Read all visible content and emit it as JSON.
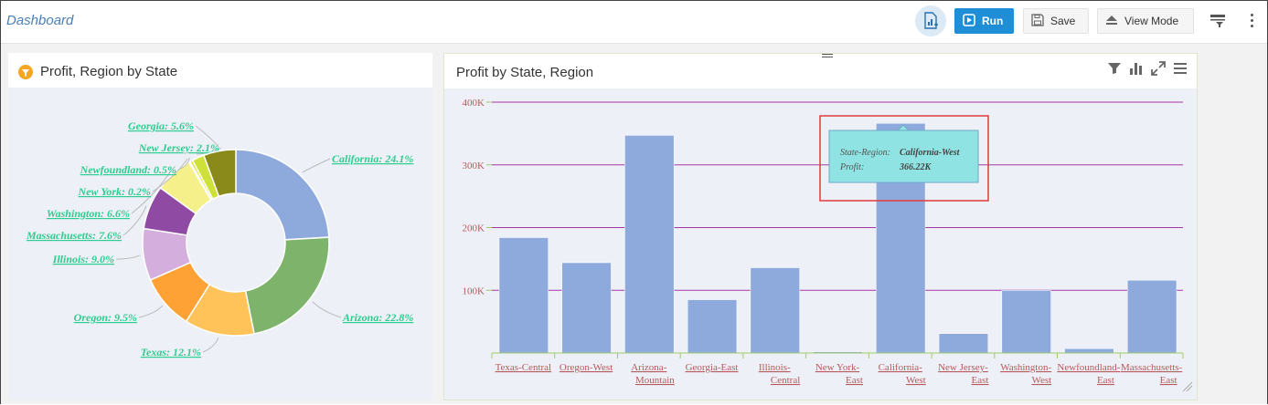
{
  "app": {
    "title": "Dashboard"
  },
  "toolbar": {
    "run_label": "Run",
    "save_label": "Save",
    "view_mode_label": "View Mode"
  },
  "left_panel": {
    "title": "Profit, Region by State"
  },
  "right_panel": {
    "title": "Profit by State, Region"
  },
  "tooltip": {
    "key1": "State-Region:",
    "val1": "California-West",
    "key2": "Profit:",
    "val2": "366.22K"
  },
  "colors": {
    "accent": "#1e8fd6",
    "bar": "#8eaadc",
    "grid": "#a535a5",
    "label_green": "#2ecc8e",
    "tooltip_bg": "#8fe3e3",
    "highlight": "#e03a3a"
  },
  "chart_data": [
    {
      "type": "pie",
      "title": "Profit, Region by State",
      "slices": [
        {
          "label": "California",
          "value": 24.1,
          "color": "#8eaadc"
        },
        {
          "label": "Arizona",
          "value": 22.8,
          "color": "#7db36a"
        },
        {
          "label": "Texas",
          "value": 12.1,
          "color": "#ffc35a"
        },
        {
          "label": "Oregon",
          "value": 9.5,
          "color": "#ffa236"
        },
        {
          "label": "Illinois",
          "value": 9.0,
          "color": "#d4aedc"
        },
        {
          "label": "Massachusetts",
          "value": 7.6,
          "color": "#8f4ba3"
        },
        {
          "label": "Washington",
          "value": 6.6,
          "color": "#f6f08a"
        },
        {
          "label": "New York",
          "value": 0.2,
          "color": "#f0e0f0"
        },
        {
          "label": "Newfoundland",
          "value": 0.5,
          "color": "#e6e640"
        },
        {
          "label": "New Jersey",
          "value": 2.1,
          "color": "#cee03a"
        },
        {
          "label": "Georgia",
          "value": 5.6,
          "color": "#8a8a1a"
        }
      ],
      "display_labels": [
        "California: 24.1%",
        "Arizona: 22.8%",
        "Texas: 12.1%",
        "Oregon: 9.5%",
        "Illinois: 9.0%",
        "Massachusetts: 7.6%",
        "Washington: 6.6%",
        "New York: 0.2%",
        "Newfoundland: 0.5%",
        "New Jersey: 2.1%",
        "Georgia: 5.6%"
      ]
    },
    {
      "type": "bar",
      "title": "Profit by State, Region",
      "categories": [
        "Texas-Central",
        "Oregon-West",
        "Arizona-Mountain",
        "Georgia-East",
        "Illinois-Central",
        "New York-East",
        "California-West",
        "New Jersey-East",
        "Washington-West",
        "Newfoundland-East",
        "Massachusetts-East"
      ],
      "category_lines": [
        [
          "Texas-Central"
        ],
        [
          "Oregon-West"
        ],
        [
          "Arizona-",
          "Mountain"
        ],
        [
          "Georgia-East"
        ],
        [
          "Illinois-",
          "Central"
        ],
        [
          "New York-",
          "East"
        ],
        [
          "California-",
          "West"
        ],
        [
          "New Jersey-",
          "East"
        ],
        [
          "Washington-",
          "West"
        ],
        [
          "Newfoundland-",
          "East"
        ],
        [
          "Massachusetts-",
          "East"
        ]
      ],
      "values": [
        184,
        144,
        347,
        85,
        136,
        2,
        366.22,
        31,
        100,
        7,
        116
      ],
      "ylim": [
        0,
        400
      ],
      "yticks": [
        "100K",
        "200K",
        "300K",
        "400K"
      ],
      "ytick_values": [
        100,
        200,
        300,
        400
      ],
      "grid": true
    }
  ]
}
